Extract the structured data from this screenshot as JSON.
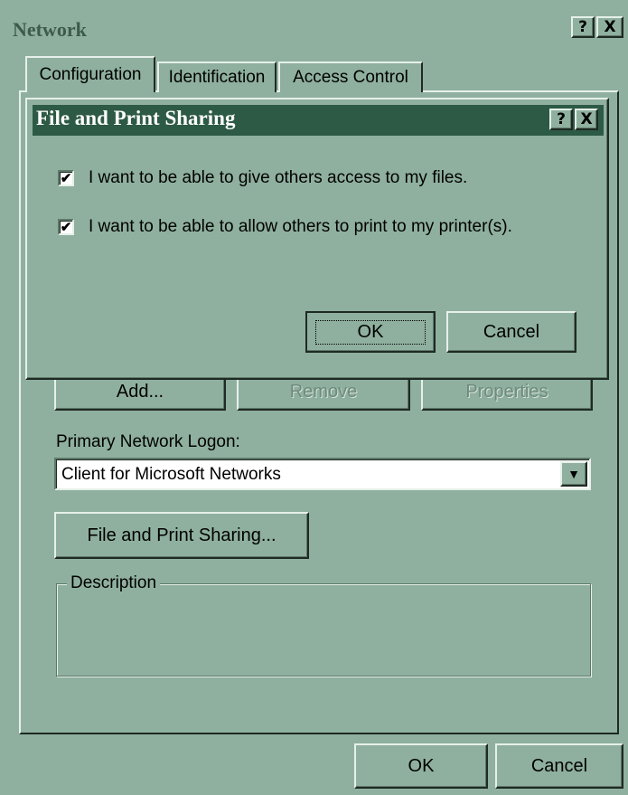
{
  "window": {
    "title": "Network",
    "help_glyph": "?",
    "close_glyph": "X"
  },
  "tabs": [
    {
      "label": "Configuration"
    },
    {
      "label": "Identification"
    },
    {
      "label": "Access Control"
    }
  ],
  "dialog": {
    "title": "File and Print Sharing",
    "help_glyph": "?",
    "close_glyph": "X",
    "checkboxes": [
      {
        "label": "I want to be able to give others access to my files.",
        "checked": true
      },
      {
        "label": "I want to be able to allow others to print to my printer(s).",
        "checked": true
      }
    ],
    "ok_label": "OK",
    "cancel_label": "Cancel"
  },
  "config": {
    "add_label": "Add...",
    "remove_label": "Remove",
    "properties_label": "Properties",
    "primary_logon_label": "Primary Network Logon:",
    "primary_logon_value": "Client for Microsoft Networks",
    "file_print_button": "File and Print Sharing...",
    "description_label": "Description"
  },
  "footer": {
    "ok_label": "OK",
    "cancel_label": "Cancel"
  },
  "colors": {
    "face": "#8fb09f",
    "dialog_titlebar": "#2d5a45",
    "outer_title_text": "#3e5a4b"
  }
}
